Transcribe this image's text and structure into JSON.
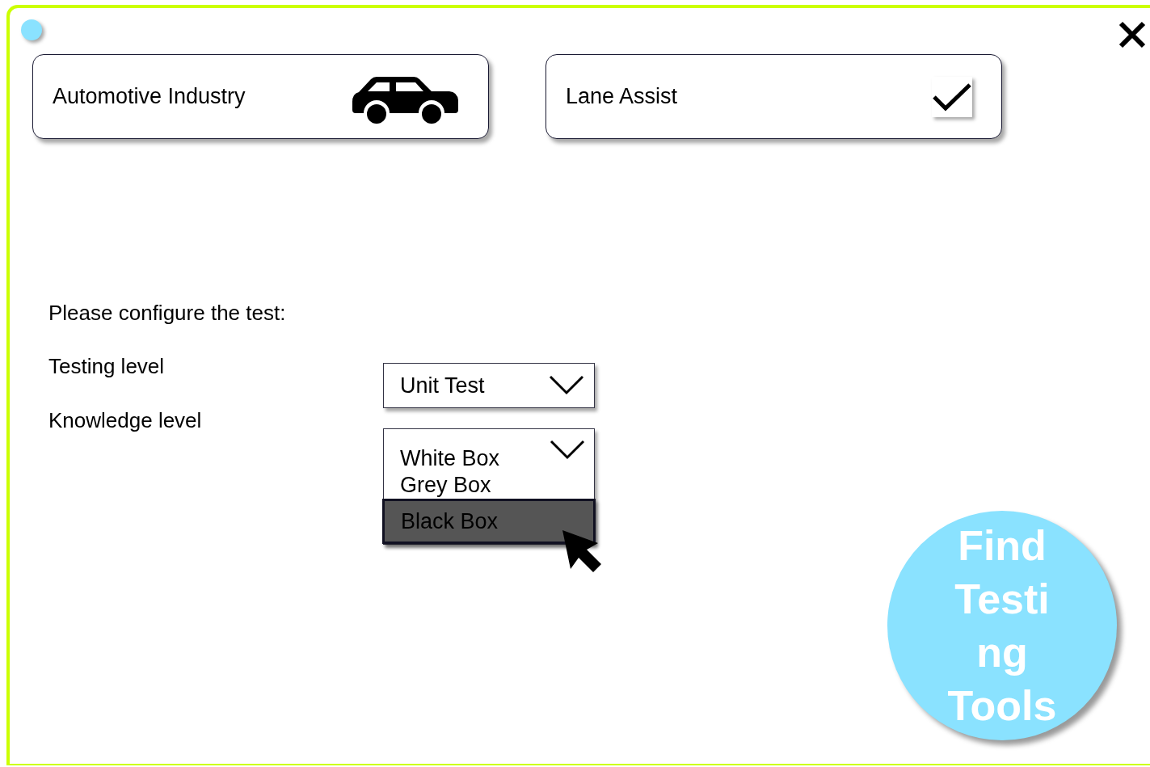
{
  "cards": [
    {
      "kind": "icon",
      "label": "Automotive Industry"
    },
    {
      "kind": "check",
      "label": "Lane Assist",
      "checked": true
    }
  ],
  "prompt": "Please configure the test:",
  "fields": [
    {
      "label": "Testing level",
      "expanded": false,
      "value": "Unit Test"
    },
    {
      "label": "Knowledge level",
      "expanded": true,
      "options": [
        {
          "label": "White Box",
          "selected": false
        },
        {
          "label": "Grey Box",
          "selected": false
        },
        {
          "label": "Black Box",
          "selected": true
        }
      ]
    }
  ],
  "action_button": "Find Testing Tools"
}
